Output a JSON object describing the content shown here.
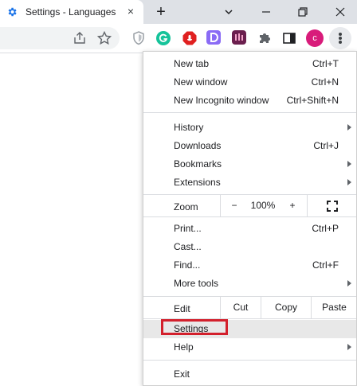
{
  "tab": {
    "title": "Settings - Languages",
    "close_glyph": "×"
  },
  "newtab_glyph": "+",
  "window_controls": {
    "icons": [
      "chevron-down-icon",
      "minimize-icon",
      "restore-icon",
      "close-icon"
    ]
  },
  "toolbar": {
    "icons": [
      "share-icon",
      "star-icon",
      "shield-extension-icon",
      "grammarly-icon",
      "adblock-icon",
      "d-extension-icon",
      "pl-extension-icon",
      "puzzle-icon",
      "sidepanel-icon"
    ],
    "avatar_letter": "c",
    "colors": {
      "grammarly": "#15c39a",
      "adblock": "#e02020",
      "d_ext": "#8a6bf5",
      "pl_ext": "#6b1f4e",
      "avatar": "#d81b7a"
    }
  },
  "menu": {
    "items": [
      {
        "label": "New tab",
        "shortcut": "Ctrl+T"
      },
      {
        "label": "New window",
        "shortcut": "Ctrl+N"
      },
      {
        "label": "New Incognito window",
        "shortcut": "Ctrl+Shift+N"
      },
      {
        "label": "History",
        "shortcut": ""
      },
      {
        "label": "Downloads",
        "shortcut": "Ctrl+J"
      },
      {
        "label": "Bookmarks",
        "shortcut": ""
      },
      {
        "label": "Extensions",
        "shortcut": ""
      },
      {
        "label": "Print...",
        "shortcut": "Ctrl+P"
      },
      {
        "label": "Cast...",
        "shortcut": ""
      },
      {
        "label": "Find...",
        "shortcut": "Ctrl+F"
      },
      {
        "label": "More tools",
        "shortcut": ""
      },
      {
        "label": "Settings",
        "shortcut": ""
      },
      {
        "label": "Help",
        "shortcut": ""
      },
      {
        "label": "Exit",
        "shortcut": ""
      }
    ],
    "zoom": {
      "label": "Zoom",
      "minus": "−",
      "value": "100%",
      "plus": "+"
    },
    "edit": {
      "label": "Edit",
      "cut": "Cut",
      "copy": "Copy",
      "paste": "Paste"
    },
    "highlight_color": "#d3202c"
  }
}
